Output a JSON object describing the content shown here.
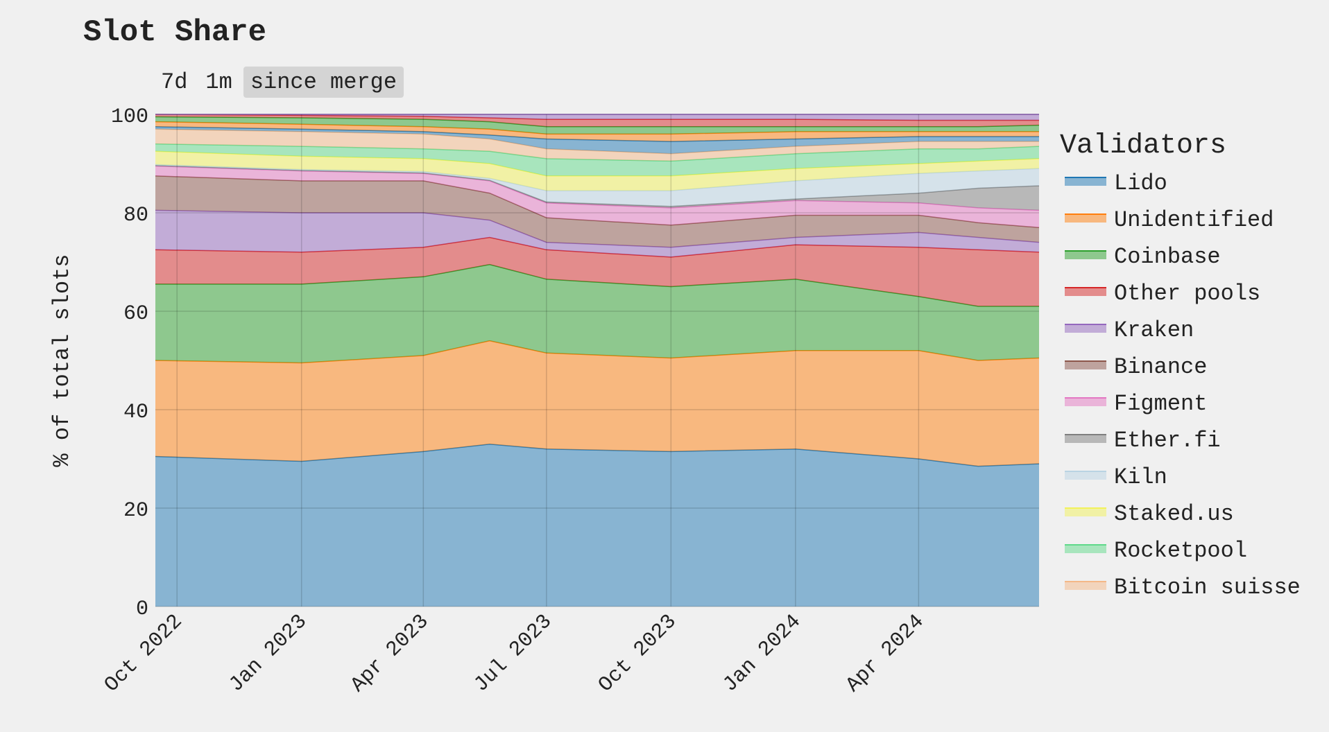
{
  "title": "Slot Share",
  "range_buttons": [
    {
      "label": "7d",
      "active": false
    },
    {
      "label": "1m",
      "active": false
    },
    {
      "label": "since merge",
      "active": true
    }
  ],
  "chart_data": {
    "type": "area",
    "stacked": true,
    "title": "Slot Share",
    "ylabel": "% of total slots",
    "xlabel": "",
    "ylim": [
      0,
      100
    ],
    "xlim": [
      "2022-09-15",
      "2024-06-29"
    ],
    "yticks": [
      0,
      20,
      40,
      60,
      80,
      100
    ],
    "xticks": [
      {
        "date": "2022-10-01",
        "label": "Oct 2022"
      },
      {
        "date": "2023-01-01",
        "label": "Jan 2023"
      },
      {
        "date": "2023-04-01",
        "label": "Apr 2023"
      },
      {
        "date": "2023-07-01",
        "label": "Jul 2023"
      },
      {
        "date": "2023-10-01",
        "label": "Oct 2023"
      },
      {
        "date": "2024-01-01",
        "label": "Jan 2024"
      },
      {
        "date": "2024-04-01",
        "label": "Apr 2024"
      }
    ],
    "grid": true,
    "legend_title": "Validators",
    "legend_position": "right",
    "x": [
      "2022-09-15",
      "2023-01-01",
      "2023-04-01",
      "2023-05-20",
      "2023-07-01",
      "2023-10-01",
      "2024-01-01",
      "2024-04-01",
      "2024-05-15",
      "2024-06-29"
    ],
    "series": [
      {
        "name": "Lido",
        "color": "#1f77b4",
        "values": [
          30.5,
          29.5,
          31.5,
          33,
          32,
          31.5,
          32,
          30,
          28.5,
          29
        ]
      },
      {
        "name": "Unidentified",
        "color": "#ff7f0e",
        "values": [
          19.5,
          20,
          19.5,
          21,
          19.5,
          19,
          20,
          22,
          21.5,
          21.5
        ]
      },
      {
        "name": "Coinbase",
        "color": "#2ca02c",
        "values": [
          15.5,
          16,
          16,
          15.5,
          15,
          14.5,
          14.5,
          11,
          11,
          10.5
        ]
      },
      {
        "name": "Other pools",
        "color": "#d62728",
        "values": [
          7,
          6.5,
          6,
          5.5,
          6,
          6,
          7,
          10,
          11.5,
          11
        ]
      },
      {
        "name": "Kraken",
        "color": "#9467bd",
        "values": [
          8,
          8,
          7,
          3.5,
          1.5,
          2,
          1.5,
          3,
          2.5,
          2
        ]
      },
      {
        "name": "Binance",
        "color": "#8c564b",
        "values": [
          7,
          6.5,
          6.5,
          5.5,
          5,
          4.5,
          4.5,
          3.5,
          3,
          3
        ]
      },
      {
        "name": "Figment",
        "color": "#e377c2",
        "values": [
          2,
          2,
          1.5,
          2.5,
          3,
          3.5,
          3,
          2.5,
          3,
          3.5
        ]
      },
      {
        "name": "Ether.fi",
        "color": "#7f7f7f",
        "values": [
          0.1,
          0.1,
          0.1,
          0.1,
          0.2,
          0.3,
          0.3,
          2,
          4,
          5
        ]
      },
      {
        "name": "Kiln",
        "color": "#b9d3e3",
        "values": [
          0.2,
          0.2,
          0.3,
          0.4,
          2.3,
          3.2,
          3.7,
          4,
          3.5,
          3.5
        ]
      },
      {
        "name": "Staked.us",
        "color": "#f2f25a",
        "values": [
          2.7,
          2.7,
          2.6,
          3,
          3,
          3,
          2.5,
          2,
          2,
          2
        ]
      },
      {
        "name": "Rocketpool",
        "color": "#5fd98a",
        "values": [
          1.5,
          2,
          2,
          2.5,
          3.5,
          3,
          3,
          3,
          2.5,
          2.5
        ]
      },
      {
        "name": "Bitcoin suisse",
        "color": "#f4b887",
        "values": [
          3,
          3,
          3,
          2.5,
          2,
          1.5,
          1.5,
          1.5,
          1.5,
          1
        ]
      },
      {
        "color": "#1f77b4",
        "values": [
          0.5,
          0.5,
          0.5,
          0.8,
          2,
          2.5,
          1.5,
          1,
          1,
          1
        ]
      },
      {
        "color": "#ff7f0e",
        "values": [
          1,
          1,
          1,
          1.2,
          1,
          1.5,
          1.5,
          1,
          1,
          1
        ]
      },
      {
        "color": "#2ca02c",
        "values": [
          1,
          1.3,
          1.5,
          1.5,
          1.5,
          1.5,
          1,
          1,
          1,
          1.3
        ]
      },
      {
        "color": "#d62728",
        "values": [
          0.5,
          0.5,
          0.6,
          0.8,
          1.5,
          1.5,
          1.5,
          1.3,
          1.3,
          1
        ]
      },
      {
        "color": "#9467bd",
        "values": [
          0,
          0.2,
          0.4,
          0.7,
          1,
          1,
          1,
          1.2,
          1.2,
          1.2
        ]
      }
    ]
  }
}
